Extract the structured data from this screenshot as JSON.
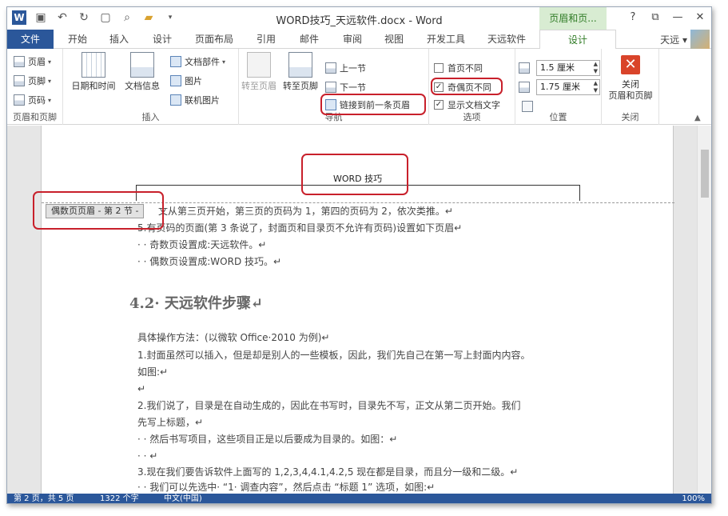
{
  "titlebar": {
    "doc_title": "WORD技巧_天远软件.docx - Word",
    "context_title": "页眉和页...",
    "help": "?",
    "restore": "⧉",
    "minimize": "—",
    "close": "✕"
  },
  "tabs": {
    "file": "文件",
    "home": "开始",
    "insert": "插入",
    "design1": "设计",
    "layout": "页面布局",
    "references": "引用",
    "mailings": "邮件",
    "review": "审阅",
    "view": "视图",
    "developer": "开发工具",
    "tianyuan": "天远软件",
    "design": "设计",
    "user": "天远"
  },
  "ribbon": {
    "hf": {
      "header": "页眉",
      "footer": "页脚",
      "pagenum": "页码",
      "label": "页眉和页脚"
    },
    "insert": {
      "datetime": "日期和时间",
      "docinfo": "文档信息",
      "parts": "文档部件",
      "picture": "图片",
      "online": "联机图片",
      "label": "插入"
    },
    "nav": {
      "goto_header": "转至页眉",
      "goto_footer": "转至页脚",
      "prev": "上一节",
      "next": "下一节",
      "link": "链接到前一条页眉",
      "label": "导航"
    },
    "options": {
      "diff_first": "首页不同",
      "diff_oddeven": "奇偶页不同",
      "show_text": "显示文档文字",
      "label": "选项"
    },
    "position": {
      "header_pos": "1.5 厘米",
      "footer_pos": "1.75 厘米",
      "label": "位置"
    },
    "close": {
      "close_line1": "关闭",
      "close_line2": "页眉和页脚",
      "label": "关闭"
    }
  },
  "document": {
    "header_text": "WORD 技巧",
    "header_tag": "偶数页页眉 - 第 2 节 -",
    "lines": [
      "文从第三页开始，第三页的页码为 1，第四的页码为 2，依次类推。↵",
      "5.有页码的页面(第 3 条说了，封面页和目录页不允许有页码)设置如下页眉↵",
      "· · 奇数页设置成:天远软件。↵",
      "· · 偶数页设置成:WORD 技巧。↵"
    ],
    "heading": "4.2· 天远软件步骤↵",
    "body": [
      "具体操作方法：(以微软 Office·2010 为例)↵",
      "1.封面虽然可以插入，但是却是别人的一些模板，因此，我们先自己在第一写上封面内内容。",
      "如图:↵",
      "↵",
      "2.我们说了，目录是在自动生成的，因此在书写时，目录先不写，正文从第二页开始。我们",
      "先写上标题，↵",
      "· · 然后书写项目，这些项目正是以后要成为目录的。如图：↵",
      "· · ↵",
      "3.现在我们要告诉软件上面写的 1,2,3,4,4.1,4.2,5 现在都是目录，而且分一级和二级。↵",
      "· · 我们可以先选中· “1· 调查内容”，然后点击 “标题 1” 选项，如图:↵"
    ]
  },
  "status": {
    "page": "第 2 页，共 5 页",
    "words": "1322 个字",
    "lang": "中文(中国)",
    "zoom": "100%"
  },
  "colors": {
    "accent": "#2b579a",
    "context_green": "#2f7b25",
    "highlight_red": "#c8202b"
  }
}
